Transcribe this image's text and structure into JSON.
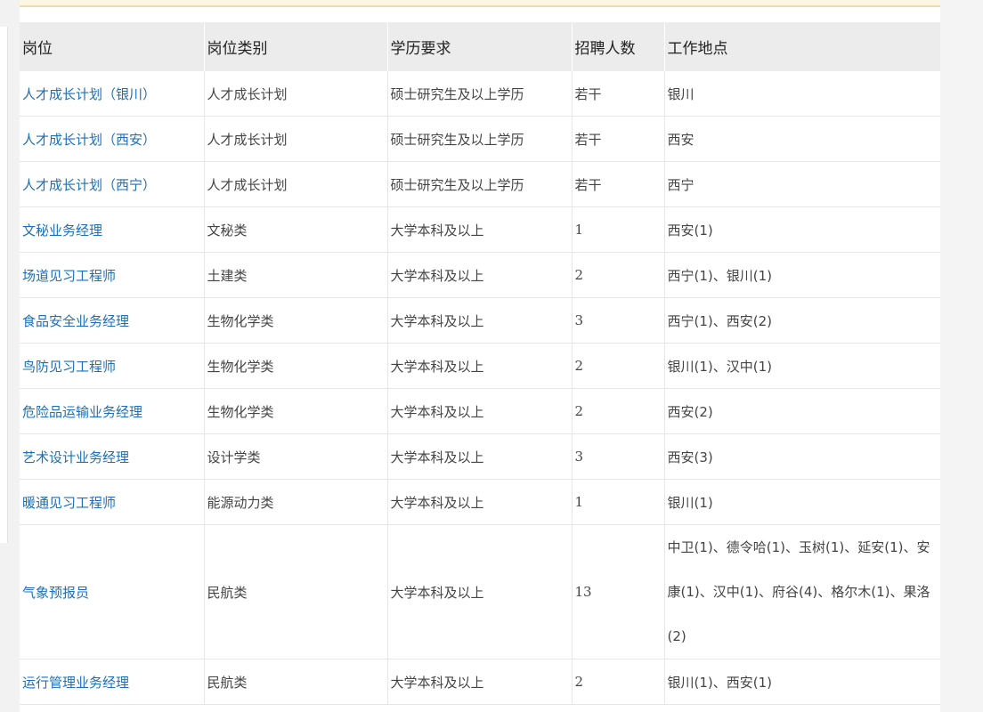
{
  "table": {
    "headers": [
      "岗位",
      "岗位类别",
      "学历要求",
      "招聘人数",
      "工作地点"
    ],
    "rows": [
      {
        "position": "人才成长计划（银川）",
        "category": "人才成长计划",
        "education": "硕士研究生及以上学历",
        "count": "若干",
        "location": "银川"
      },
      {
        "position": "人才成长计划（西安）",
        "category": "人才成长计划",
        "education": "硕士研究生及以上学历",
        "count": "若干",
        "location": "西安"
      },
      {
        "position": "人才成长计划（西宁）",
        "category": "人才成长计划",
        "education": "硕士研究生及以上学历",
        "count": "若干",
        "location": "西宁"
      },
      {
        "position": "文秘业务经理",
        "category": "文秘类",
        "education": "大学本科及以上",
        "count": "1",
        "location": "西安(1)"
      },
      {
        "position": "场道见习工程师",
        "category": "土建类",
        "education": "大学本科及以上",
        "count": "2",
        "location": "西宁(1)、银川(1)"
      },
      {
        "position": "食品安全业务经理",
        "category": "生物化学类",
        "education": "大学本科及以上",
        "count": "3",
        "location": "西宁(1)、西安(2)"
      },
      {
        "position": "鸟防见习工程师",
        "category": "生物化学类",
        "education": "大学本科及以上",
        "count": "2",
        "location": "银川(1)、汉中(1)"
      },
      {
        "position": "危险品运输业务经理",
        "category": "生物化学类",
        "education": "大学本科及以上",
        "count": "2",
        "location": "西安(2)"
      },
      {
        "position": "艺术设计业务经理",
        "category": "设计学类",
        "education": "大学本科及以上",
        "count": "3",
        "location": "西安(3)"
      },
      {
        "position": "暖通见习工程师",
        "category": "能源动力类",
        "education": "大学本科及以上",
        "count": "1",
        "location": "银川(1)"
      },
      {
        "position": "气象预报员",
        "category": "民航类",
        "education": "大学本科及以上",
        "count": "13",
        "location": "中卫(1)、德令哈(1)、玉树(1)、延安(1)、安康(1)、汉中(1)、府谷(4)、格尔木(1)、果洛(2)"
      },
      {
        "position": "运行管理业务经理",
        "category": "民航类",
        "education": "大学本科及以上",
        "count": "2",
        "location": "银川(1)、西安(1)"
      }
    ]
  }
}
